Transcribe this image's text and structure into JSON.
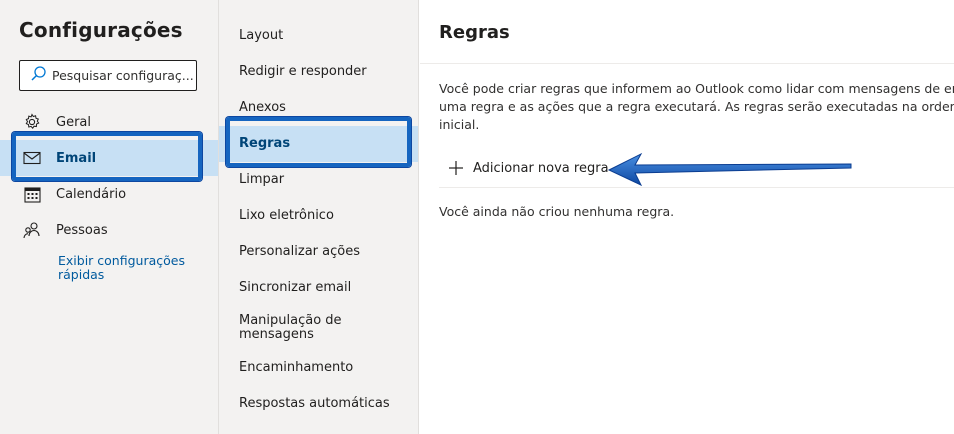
{
  "settings": {
    "title": "Configurações",
    "search_placeholder": "Pesquisar configuraç...",
    "nav": [
      {
        "label": "Geral",
        "icon": "gear-icon"
      },
      {
        "label": "Email",
        "icon": "mail-icon",
        "selected": true
      },
      {
        "label": "Calendário",
        "icon": "calendar-icon"
      },
      {
        "label": "Pessoas",
        "icon": "people-icon"
      }
    ],
    "quick_settings_line1": "Exibir configurações",
    "quick_settings_line2": "rápidas"
  },
  "email_menu": {
    "items": [
      {
        "label": "Layout"
      },
      {
        "label": "Redigir e responder"
      },
      {
        "label": "Anexos"
      },
      {
        "label": "Regras",
        "selected": true
      },
      {
        "label": "Limpar"
      },
      {
        "label": "Lixo eletrônico"
      },
      {
        "label": "Personalizar ações"
      },
      {
        "label": "Sincronizar email"
      },
      {
        "label_line1": "Manipulação de",
        "label_line2": "mensagens"
      },
      {
        "label": "Encaminhamento"
      },
      {
        "label": "Respostas automáticas"
      }
    ]
  },
  "rules": {
    "title": "Regras",
    "description_line1": "Você pode criar regras que informem ao Outlook como lidar com mensagens de em",
    "description_line2": "uma regra e as ações que a regra executará. As regras serão executadas na ordem m",
    "description_line3": "inicial.",
    "add_rule_label": "Adicionar nova regra",
    "empty_message": "Você ainda não criou nenhuma regra."
  },
  "colors": {
    "selected_bg": "#c7e0f4",
    "link": "#005a9e",
    "highlight_border": "#1565c0",
    "pane_bg": "#f3f2f1"
  }
}
